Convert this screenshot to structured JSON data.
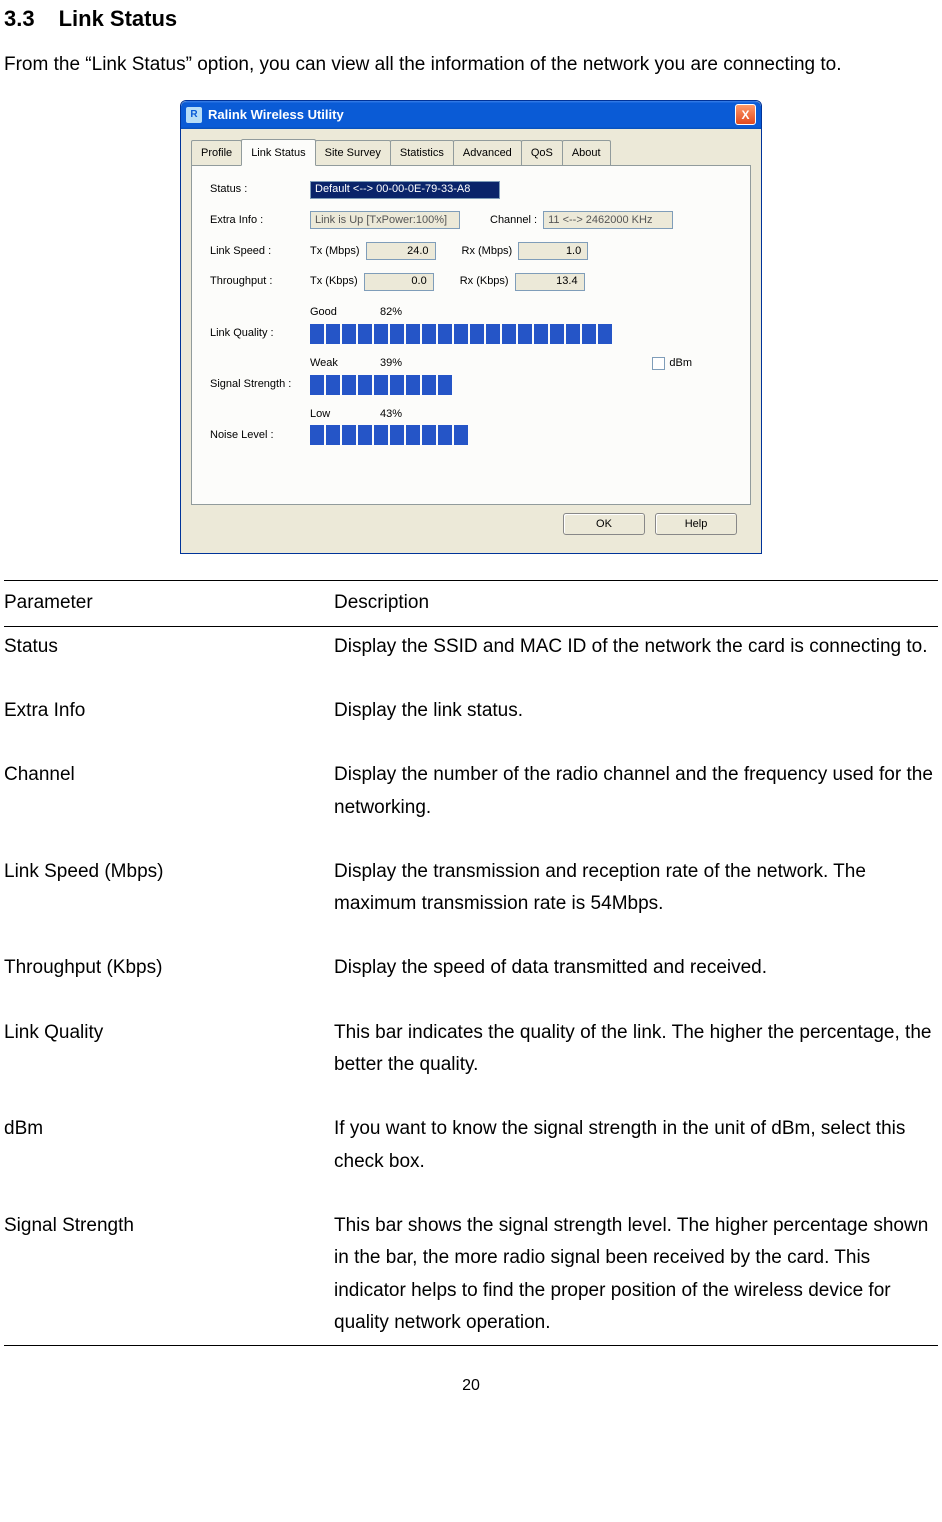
{
  "heading": {
    "number": "3.3",
    "title": "Link Status"
  },
  "intro": "From the “Link Status” option, you can view all the information of the network you are connecting to.",
  "window": {
    "title": "Ralink Wireless Utility",
    "close_glyph": "X",
    "tabs": [
      "Profile",
      "Link Status",
      "Site Survey",
      "Statistics",
      "Advanced",
      "QoS",
      "About"
    ],
    "active_tab_index": 1,
    "labels": {
      "status": "Status :",
      "extra_info": "Extra Info :",
      "channel": "Channel :",
      "link_speed": "Link Speed :",
      "throughput": "Throughput :",
      "tx_mbps": "Tx (Mbps)",
      "rx_mbps": "Rx (Mbps)",
      "tx_kbps": "Tx (Kbps)",
      "rx_kbps": "Rx (Kbps)",
      "link_quality": "Link Quality :",
      "signal_strength": "Signal Strength :",
      "noise_level": "Noise Level :",
      "dbm": "dBm",
      "good": "Good",
      "weak": "Weak",
      "low": "Low"
    },
    "values": {
      "status": "Default <--> 00-00-0E-79-33-A8",
      "extra_info": "Link is Up [TxPower:100%]",
      "channel": "11 <--> 2462000 KHz",
      "tx_mbps": "24.0",
      "rx_mbps": "1.0",
      "tx_kbps": "0.0",
      "rx_kbps": "13.4",
      "link_quality_pct": "82%",
      "signal_strength_pct": "39%",
      "noise_level_pct": "43%"
    },
    "chart_data": {
      "type": "bar",
      "bars": [
        {
          "name": "Link Quality",
          "segments": 19,
          "max_segments": 23
        },
        {
          "name": "Signal Strength",
          "segments": 9,
          "max_segments": 23
        },
        {
          "name": "Noise Level",
          "segments": 10,
          "max_segments": 23
        }
      ]
    },
    "buttons": {
      "ok": "OK",
      "help": "Help"
    }
  },
  "table": {
    "headers": {
      "param": "Parameter",
      "desc": "Description"
    },
    "rows": [
      {
        "param": "Status",
        "desc": "Display the SSID and MAC ID of the network the card is connecting to."
      },
      {
        "param": "Extra Info",
        "desc": "Display the link status."
      },
      {
        "param": "Channel",
        "desc": "Display the number of the radio channel and the frequency used for the networking."
      },
      {
        "param": "Link Speed (Mbps)",
        "desc": "Display the transmission and reception rate of the network. The maximum transmission rate is 54Mbps."
      },
      {
        "param": "Throughput (Kbps)",
        "desc": "Display the speed of data transmitted and received."
      },
      {
        "param": "Link Quality",
        "desc": "This bar indicates the quality of the link. The higher the percentage, the better the quality."
      },
      {
        "param": "dBm",
        "desc": "If you want to know the signal strength in the unit of dBm, select this check box."
      },
      {
        "param": "Signal Strength",
        "desc": "This bar shows the signal strength level. The higher percentage shown in the bar, the more radio signal been received by the card. This indicator helps to find the proper position of the wireless device for quality network operation."
      }
    ]
  },
  "page_number": "20"
}
